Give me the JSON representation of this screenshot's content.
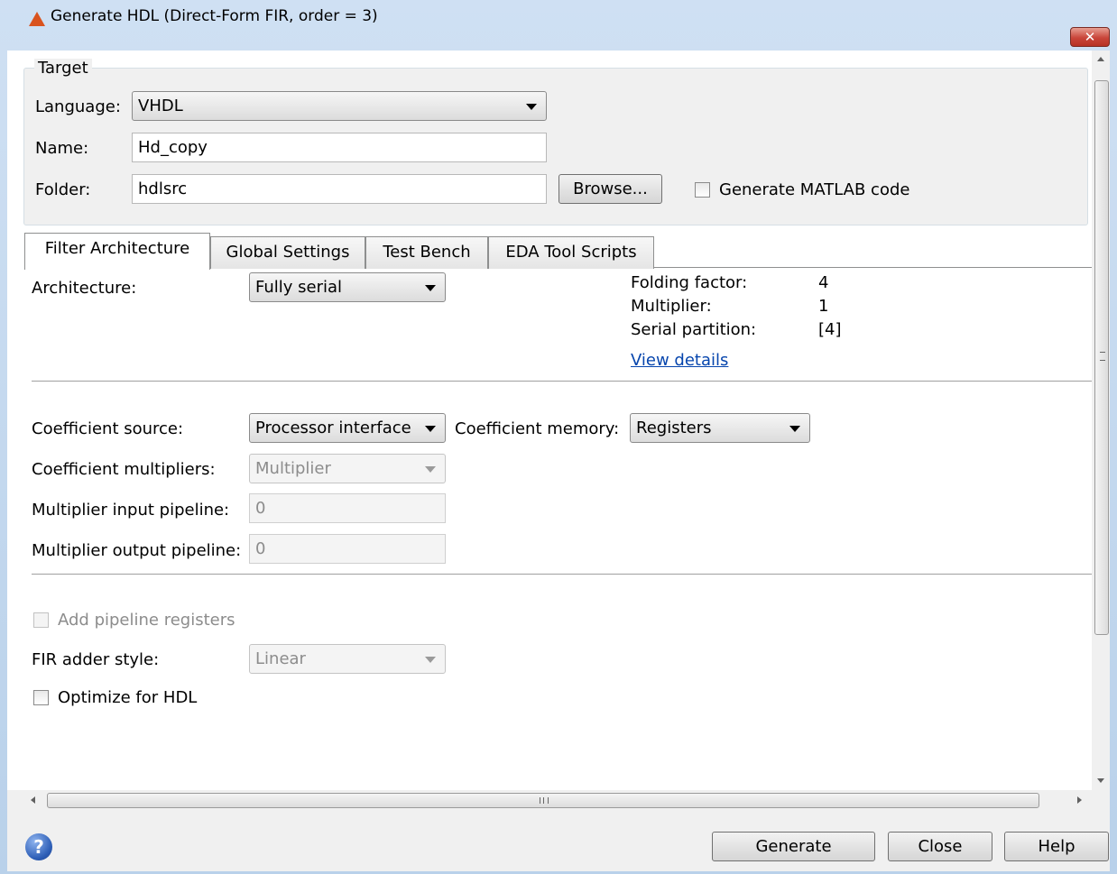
{
  "window": {
    "title": "Generate HDL (Direct-Form FIR, order = 3)",
    "close_glyph": "✕"
  },
  "target": {
    "legend": "Target",
    "language_label": "Language:",
    "language_value": "VHDL",
    "name_label": "Name:",
    "name_value": "Hd_copy",
    "folder_label": "Folder:",
    "folder_value": "hdlsrc",
    "browse_label": "Browse...",
    "generate_matlab_label": "Generate MATLAB code"
  },
  "tabs": [
    {
      "label": "Filter Architecture",
      "active": true
    },
    {
      "label": "Global Settings",
      "active": false
    },
    {
      "label": "Test Bench",
      "active": false
    },
    {
      "label": "EDA Tool Scripts",
      "active": false
    }
  ],
  "architecture": {
    "label": "Architecture:",
    "value": "Fully serial",
    "folding_label": "Folding factor:",
    "folding_value": "4",
    "multiplier_label": "Multiplier:",
    "multiplier_value": "1",
    "partition_label": "Serial partition:",
    "partition_value": "[4]",
    "view_details": "View details"
  },
  "coefficients": {
    "source_label": "Coefficient source:",
    "source_value": "Processor interface",
    "memory_label": "Coefficient memory:",
    "memory_value": "Registers",
    "multipliers_label": "Coefficient multipliers:",
    "multipliers_value": "Multiplier",
    "input_pipeline_label": "Multiplier input pipeline:",
    "input_pipeline_value": "0",
    "output_pipeline_label": "Multiplier output pipeline:",
    "output_pipeline_value": "0"
  },
  "options": {
    "add_pipeline_label": "Add pipeline registers",
    "adder_style_label": "FIR adder style:",
    "adder_style_value": "Linear",
    "optimize_label": "Optimize for HDL"
  },
  "footer": {
    "help_glyph": "?",
    "generate_label": "Generate",
    "close_label": "Close",
    "help_label": "Help"
  }
}
